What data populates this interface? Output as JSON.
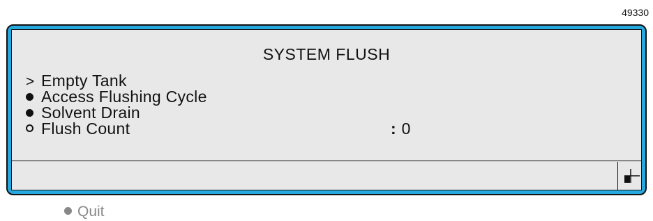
{
  "figure_id": "49330",
  "screen": {
    "title": "SYSTEM FLUSH",
    "menu_items": [
      {
        "marker": ">",
        "label": "Empty Tank"
      },
      {
        "marker": "bullet",
        "label": "Access Flushing Cycle"
      },
      {
        "marker": "bullet",
        "label": "Solvent Drain"
      },
      {
        "marker": "ring",
        "label": "Flush Count",
        "separator": ":",
        "value": "0"
      }
    ]
  },
  "softkey": {
    "marker": "bullet",
    "label": "Quit"
  },
  "colors": {
    "frame": "#25a9df",
    "panel": "#e8e8e8",
    "text": "#111111",
    "softkey_text": "#888888"
  }
}
